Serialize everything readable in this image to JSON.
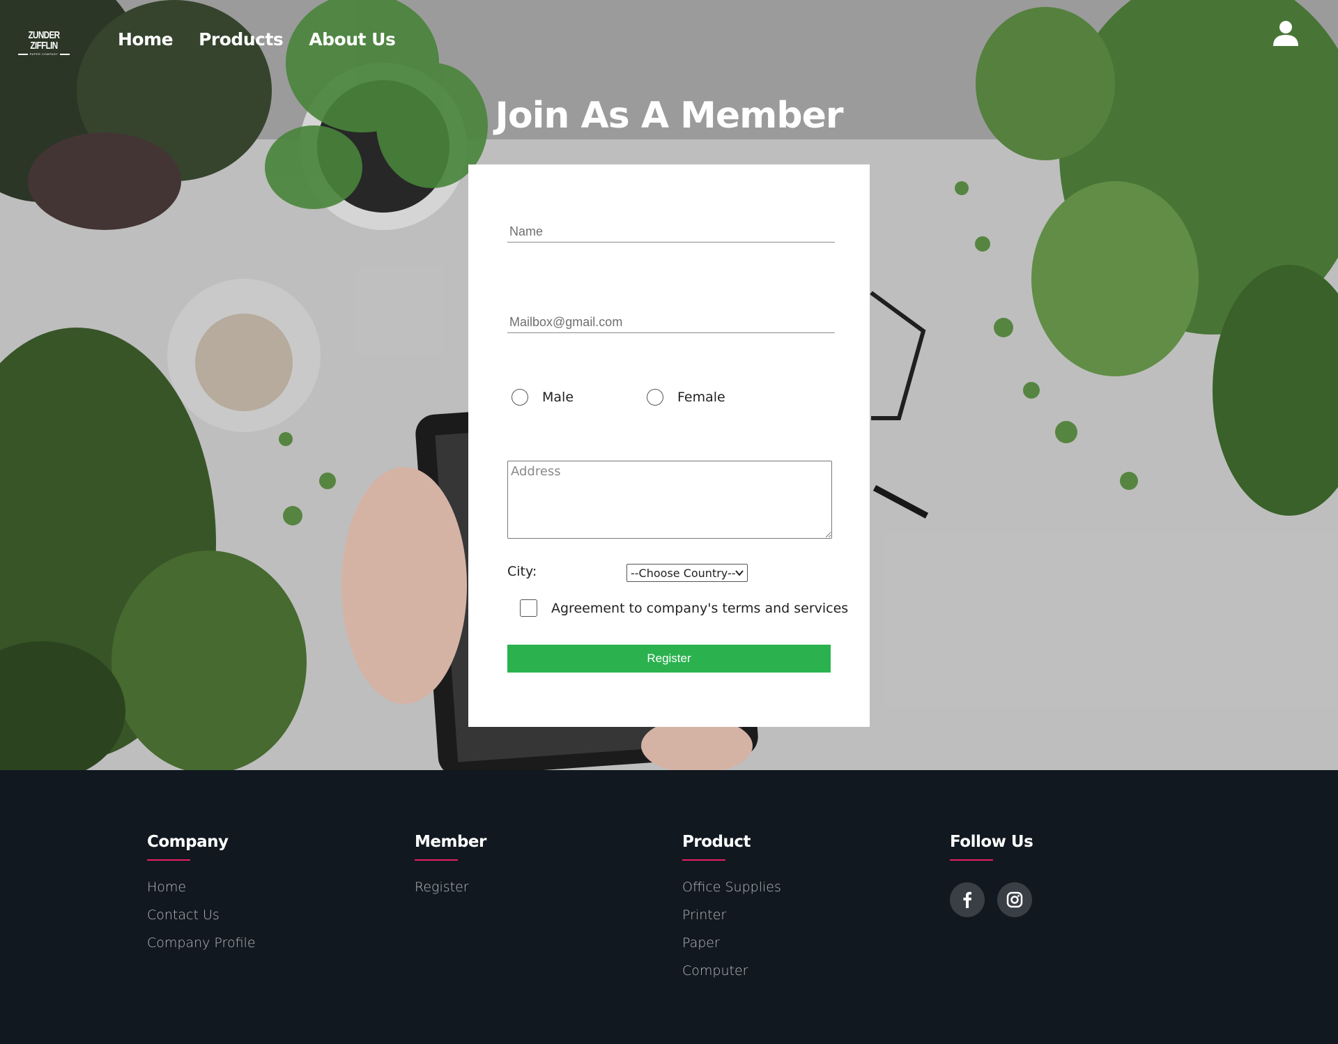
{
  "brand": {
    "logo_text": "ZUNDER ZIFFLIN",
    "logo_subtext": "PAPER COMPANY"
  },
  "nav": {
    "items": [
      "Home",
      "Products",
      "About Us"
    ]
  },
  "page": {
    "title": "Join As A Member"
  },
  "form": {
    "name_placeholder": "Name",
    "email_placeholder": "Mailbox@gmail.com",
    "gender_options": [
      "Male",
      "Female"
    ],
    "address_placeholder": "Address",
    "city_label": "City:",
    "country_select_value": "--Choose Country--",
    "agreement_label": "Agreement to company's terms and services",
    "register_label": "Register"
  },
  "footer": {
    "columns": [
      {
        "heading": "Company",
        "links": [
          "Home",
          "Contact Us",
          "Company Profile"
        ]
      },
      {
        "heading": "Member",
        "links": [
          "Register"
        ]
      },
      {
        "heading": "Product",
        "links": [
          "Office Supplies",
          "Printer",
          "Paper",
          "Computer"
        ]
      },
      {
        "heading": "Follow Us",
        "socials": [
          "facebook-icon",
          "instagram-icon"
        ]
      }
    ],
    "accent_color": "#e91e63"
  },
  "colors": {
    "register_button": "#2bb24f",
    "footer_background": "#111820"
  }
}
